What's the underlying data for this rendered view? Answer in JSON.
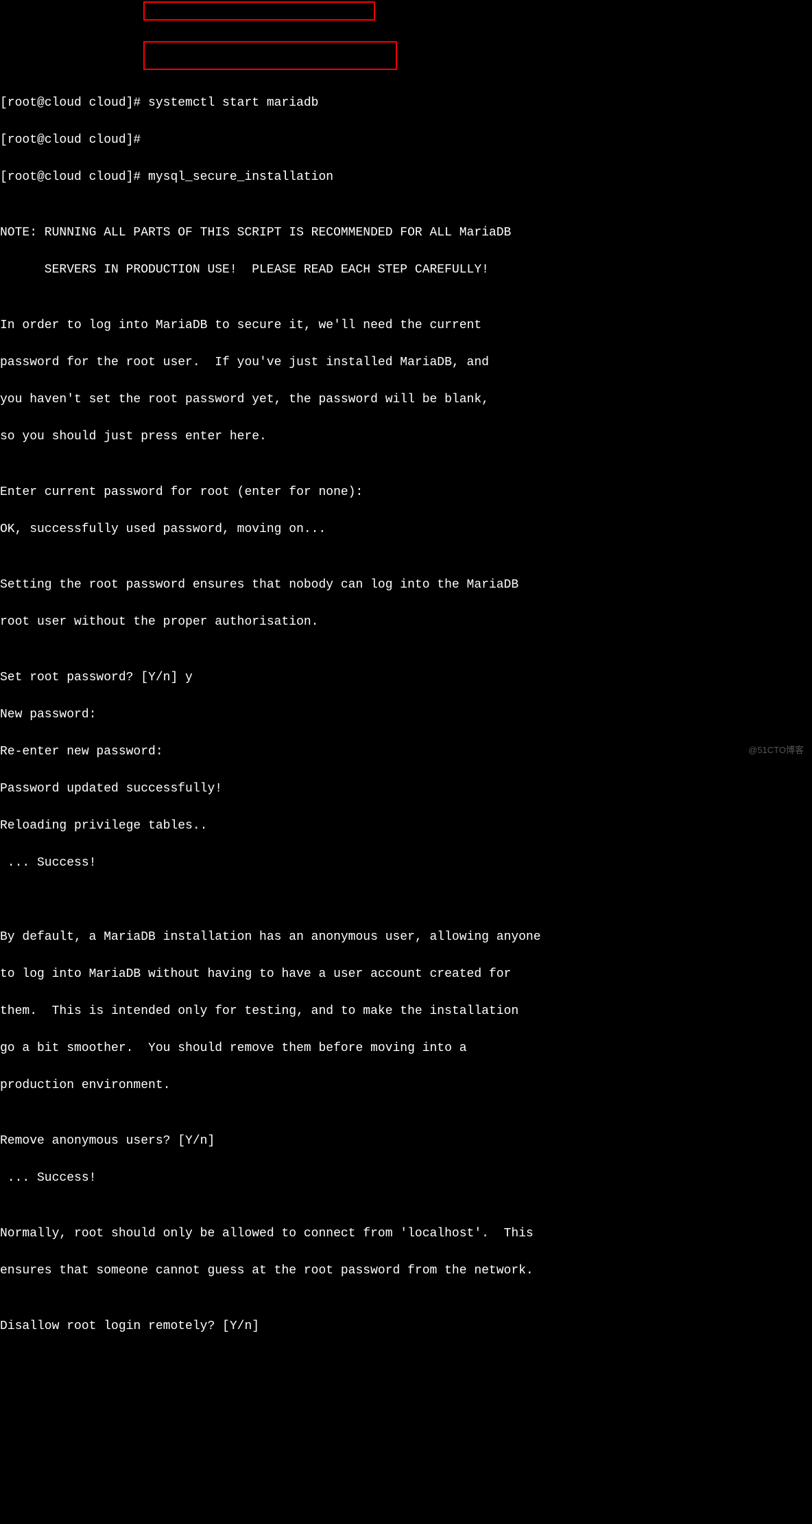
{
  "terminal": {
    "prompt": "[root@cloud cloud]#",
    "cmd1": "systemctl start mariadb",
    "cmd2": "mysql_secure_installation",
    "lines": [
      "[root@cloud cloud]# systemctl start mariadb",
      "[root@cloud cloud]#",
      "[root@cloud cloud]# mysql_secure_installation",
      "",
      "NOTE: RUNNING ALL PARTS OF THIS SCRIPT IS RECOMMENDED FOR ALL MariaDB",
      "      SERVERS IN PRODUCTION USE!  PLEASE READ EACH STEP CAREFULLY!",
      "",
      "In order to log into MariaDB to secure it, we'll need the current",
      "password for the root user.  If you've just installed MariaDB, and",
      "you haven't set the root password yet, the password will be blank,",
      "so you should just press enter here.",
      "",
      "Enter current password for root (enter for none):",
      "OK, successfully used password, moving on...",
      "",
      "Setting the root password ensures that nobody can log into the MariaDB",
      "root user without the proper authorisation.",
      "",
      "Set root password? [Y/n] y",
      "New password:",
      "Re-enter new password:",
      "Password updated successfully!",
      "Reloading privilege tables..",
      " ... Success!",
      "",
      "",
      "By default, a MariaDB installation has an anonymous user, allowing anyone",
      "to log into MariaDB without having to have a user account created for",
      "them.  This is intended only for testing, and to make the installation",
      "go a bit smoother.  You should remove them before moving into a",
      "production environment.",
      "",
      "Remove anonymous users? [Y/n]",
      " ... Success!",
      "",
      "Normally, root should only be allowed to connect from 'localhost'.  This",
      "ensures that someone cannot guess at the root password from the network.",
      "",
      "Disallow root login remotely? [Y/n]"
    ]
  },
  "watermark": "@51CTO博客"
}
